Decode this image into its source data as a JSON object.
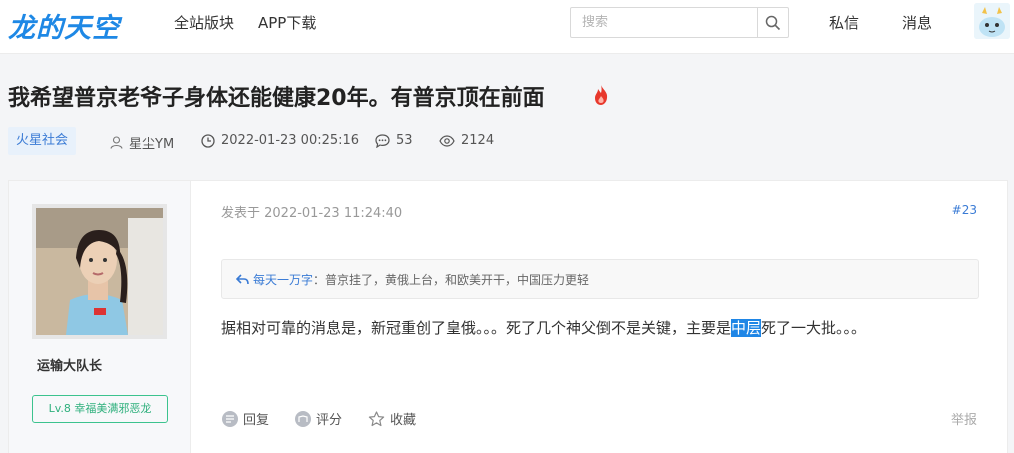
{
  "header": {
    "logo": "龙的天空",
    "nav": [
      "全站版块",
      "APP下载"
    ],
    "search_placeholder": "搜索",
    "private_msg": "私信",
    "messages": "消息"
  },
  "thread": {
    "title": "我希望普京老爷子身体还能健康20年。有普京顶在前面",
    "tag": "火星社会",
    "author": "星尘YM",
    "datetime": "2022-01-23 00:25:16",
    "comments": "53",
    "views": "2124"
  },
  "post": {
    "author": "运输大队长",
    "level": "Lv.8 幸福美满邪恶龙",
    "date": "发表于 2022-01-23 11:24:40",
    "floor": "#23",
    "quote_author": "每天一万字",
    "quote_sep": "：",
    "quote_text": "普京挂了，黄俄上台，和欧美开干，中国压力更轻",
    "body_before": "据相对可靠的消息是，新冠重创了皇俄。。。死了几个神父倒不是关键，主要是",
    "body_highlight": "中层",
    "body_after": "死了一大批。。。",
    "actions": {
      "reply": "回复",
      "rate": "评分",
      "favorite": "收藏",
      "report": "举报"
    }
  },
  "colors": {
    "brand": "#1e88e5",
    "link": "#3a7bd5",
    "badge": "#2fb07d",
    "highlight": "#1f86e6"
  }
}
